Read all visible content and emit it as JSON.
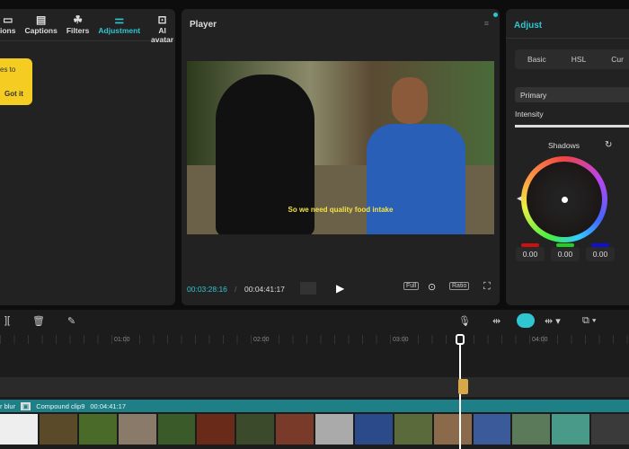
{
  "left_panel": {
    "tabs": [
      {
        "label": "ions",
        "icon": "transitions-icon"
      },
      {
        "label": "Captions",
        "icon": "captions-icon"
      },
      {
        "label": "Filters",
        "icon": "filters-icon"
      },
      {
        "label": "Adjustment",
        "icon": "sliders-icon",
        "active": true
      },
      {
        "label": "AI avatar",
        "icon": "avatar-icon"
      }
    ],
    "tooltip": {
      "text": "es to",
      "button": "Got it"
    }
  },
  "player": {
    "title": "Player",
    "subtitle": "So we need quality food intake",
    "current_time": "00:03:28:16",
    "separator": "/",
    "total_time": "00:04:41:17",
    "full_label": "Full",
    "ratio_label": "Ratio"
  },
  "adjust": {
    "title": "Adjust",
    "tabs": [
      "Basic",
      "HSL",
      "Cur"
    ],
    "dropdown": "Primary",
    "intensity_label": "Intensity",
    "wheel_label": "Shadows",
    "values": [
      "0.00",
      "0.00",
      "0.00"
    ],
    "value_colors": [
      "#d01010",
      "#20d020",
      "#1010d0"
    ],
    "accent": "#2fc6d2"
  },
  "timeline": {
    "ruler": [
      "01:00",
      "02:00",
      "03:00",
      "04:00"
    ],
    "clip_effect": "r blur",
    "clip_name": "Compound clip9",
    "clip_duration": "00:04:41:17"
  }
}
